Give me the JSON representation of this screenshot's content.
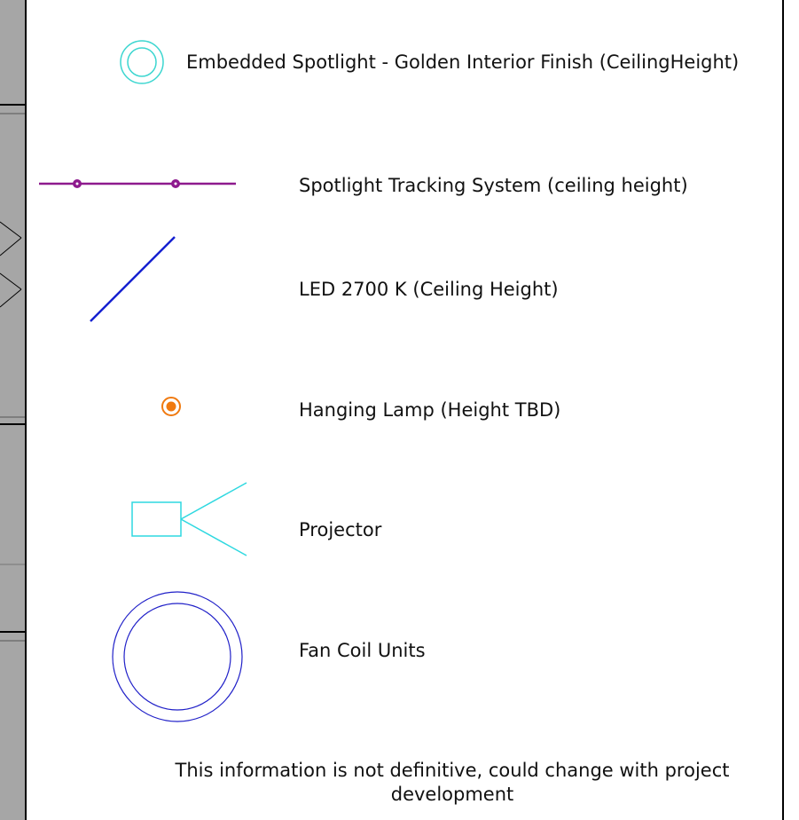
{
  "legend": {
    "items": [
      {
        "symbol": "embedded-spotlight",
        "label": "Embedded Spotlight - Golden Interior Finish (CeilingHeight)",
        "color": "#3cd6d0"
      },
      {
        "symbol": "spotlight-track",
        "label": "Spotlight Tracking System (ceiling height)",
        "color": "#8e1a8e"
      },
      {
        "symbol": "led-strip",
        "label": "LED 2700 K (Ceiling Height)",
        "color": "#1520d0"
      },
      {
        "symbol": "hanging-lamp",
        "label": "Hanging Lamp (Height TBD)",
        "color": "#f07a10"
      },
      {
        "symbol": "projector",
        "label": "Projector",
        "color": "#2ed8e0"
      },
      {
        "symbol": "fan-coil-unit",
        "label": "Fan Coil Units",
        "color": "#2020c8"
      }
    ],
    "note": "This information is not definitive, could change with project development"
  }
}
